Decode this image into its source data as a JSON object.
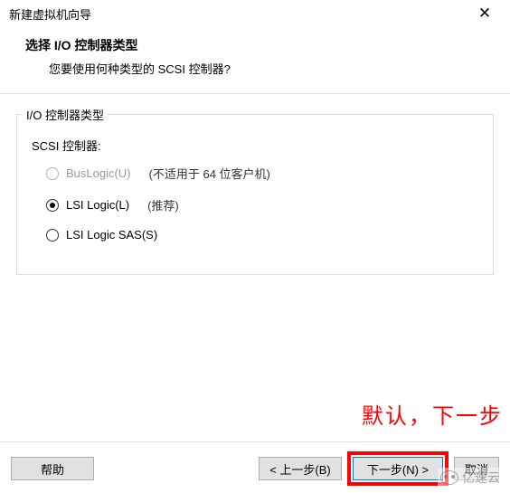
{
  "window": {
    "title": "新建虚拟机向导"
  },
  "header": {
    "heading": "选择 I/O 控制器类型",
    "subheading": "您要使用何种类型的 SCSI 控制器?"
  },
  "group": {
    "legend": "I/O 控制器类型",
    "scsi_label": "SCSI 控制器:",
    "options": {
      "buslogic": {
        "label": "BusLogic(U)",
        "hint": "(不适用于 64 位客户机)",
        "selected": false,
        "disabled": true
      },
      "lsilogic": {
        "label": "LSI Logic(L)",
        "hint": "(推荐)",
        "selected": true,
        "disabled": false
      },
      "lsisas": {
        "label": "LSI Logic SAS(S)",
        "hint": "",
        "selected": false,
        "disabled": false
      }
    }
  },
  "annotation": "默认，下一步",
  "footer": {
    "help": "帮助",
    "back": "< 上一步(B)",
    "next": "下一步(N) >",
    "cancel": "取消"
  },
  "watermark": "亿速云"
}
